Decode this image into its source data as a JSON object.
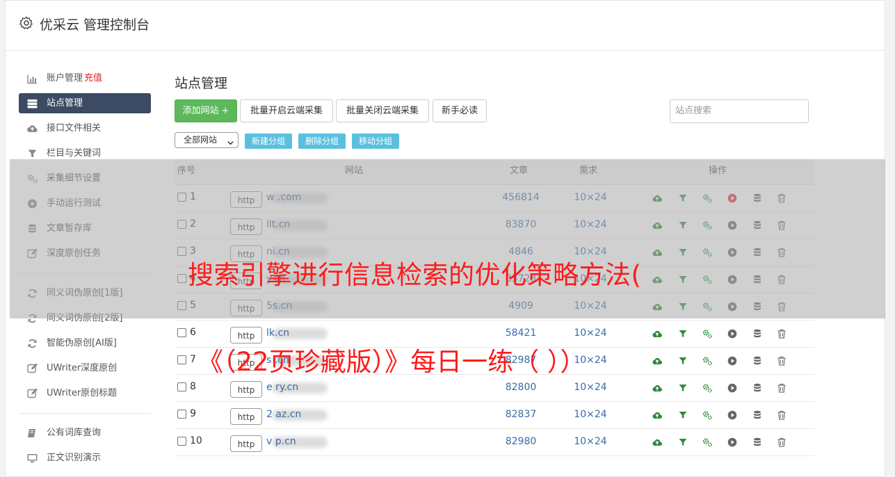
{
  "app": {
    "title": "优采云 管理控制台",
    "icon": "gear-icon"
  },
  "sidebar": {
    "group1": [
      {
        "label": "账户管理",
        "tag": "充值",
        "icon": "bar-chart-icon",
        "active": false
      },
      {
        "label": "站点管理",
        "tag": "",
        "icon": "server-icon",
        "active": true
      },
      {
        "label": "接口文件相关",
        "tag": "",
        "icon": "cloud-upload-icon",
        "active": false
      },
      {
        "label": "栏目与关键词",
        "tag": "",
        "icon": "filter-icon",
        "active": false
      },
      {
        "label": "采集细节设置",
        "tag": "",
        "icon": "cogs-icon",
        "active": false
      },
      {
        "label": "手动运行测试",
        "tag": "",
        "icon": "play-circle-icon",
        "active": false
      },
      {
        "label": "文章暂存库",
        "tag": "",
        "icon": "database-icon",
        "active": false
      },
      {
        "label": "深度原创任务",
        "tag": "",
        "icon": "edit-icon",
        "active": false
      }
    ],
    "group2": [
      {
        "label": "同义词伪原创[1版]",
        "icon": "refresh-icon"
      },
      {
        "label": "同义词伪原创[2版]",
        "icon": "refresh-icon"
      },
      {
        "label": "智能伪原创[AI版]",
        "icon": "refresh-icon"
      },
      {
        "label": "UWriter深度原创",
        "icon": "edit-icon"
      },
      {
        "label": "UWriter原创标题",
        "icon": "edit-icon"
      }
    ],
    "group3": [
      {
        "label": "公有词库查询",
        "icon": "book-icon"
      },
      {
        "label": "正文识别演示",
        "icon": "monitor-icon"
      }
    ]
  },
  "main": {
    "title": "站点管理",
    "buttons": {
      "add": "添加网站 +",
      "batch_open": "批量开启云端采集",
      "batch_close": "批量关闭云端采集",
      "guide": "新手必读"
    },
    "search_placeholder": "站点搜索",
    "group_select": "全部网站",
    "group_buttons": {
      "new": "新建分组",
      "delete": "删除分组",
      "move": "移动分组"
    },
    "table": {
      "headers": {
        "no": "序号",
        "site": "网站",
        "articles": "文章",
        "demand": "需求",
        "ops": "操作"
      },
      "rows": [
        {
          "no": "1",
          "http": "http",
          "domain": "w               .com",
          "articles": "456814",
          "demand": "10×24",
          "active": true
        },
        {
          "no": "2",
          "http": "http",
          "domain": "      llt.cn",
          "articles": "83870",
          "demand": "10×24",
          "active": false
        },
        {
          "no": "3",
          "http": "http",
          "domain": "      ni.cn",
          "articles": "4846",
          "demand": "10×24",
          "active": false
        },
        {
          "no": "4",
          "http": "http",
          "domain": "        y.cn",
          "articles": "83723",
          "demand": "10×24",
          "active": false
        },
        {
          "no": "5",
          "http": "http",
          "domain": "      5s.cn",
          "articles": "4909",
          "demand": "10×24",
          "active": false
        },
        {
          "no": "6",
          "http": "http",
          "domain": "      lk.cn",
          "articles": "58421",
          "demand": "10×24",
          "active": false
        },
        {
          "no": "7",
          "http": "http",
          "domain": "s      .cn",
          "articles": "82987",
          "demand": "10×24",
          "active": false
        },
        {
          "no": "8",
          "http": "http",
          "domain": "e        ry.cn",
          "articles": "82800",
          "demand": "10×24",
          "active": false
        },
        {
          "no": "9",
          "http": "http",
          "domain": "2      az.cn",
          "articles": "82837",
          "demand": "10×24",
          "active": false
        },
        {
          "no": "10",
          "http": "http",
          "domain": "v      p.cn",
          "articles": "82980",
          "demand": "10×24",
          "active": false
        }
      ]
    }
  },
  "overlay": {
    "title": "搜索引擎进行信息检索的优化策略方法(",
    "subtitle": "《（22页珍藏版）》每日一练（  ））"
  },
  "colors": {
    "sidebar_active": "#3c4b63",
    "green": "#5cb85c",
    "info": "#5bc0de",
    "link": "#3a6aa8",
    "overlay_text": "#ff1a1a",
    "recharge_tag": "#e02020"
  }
}
